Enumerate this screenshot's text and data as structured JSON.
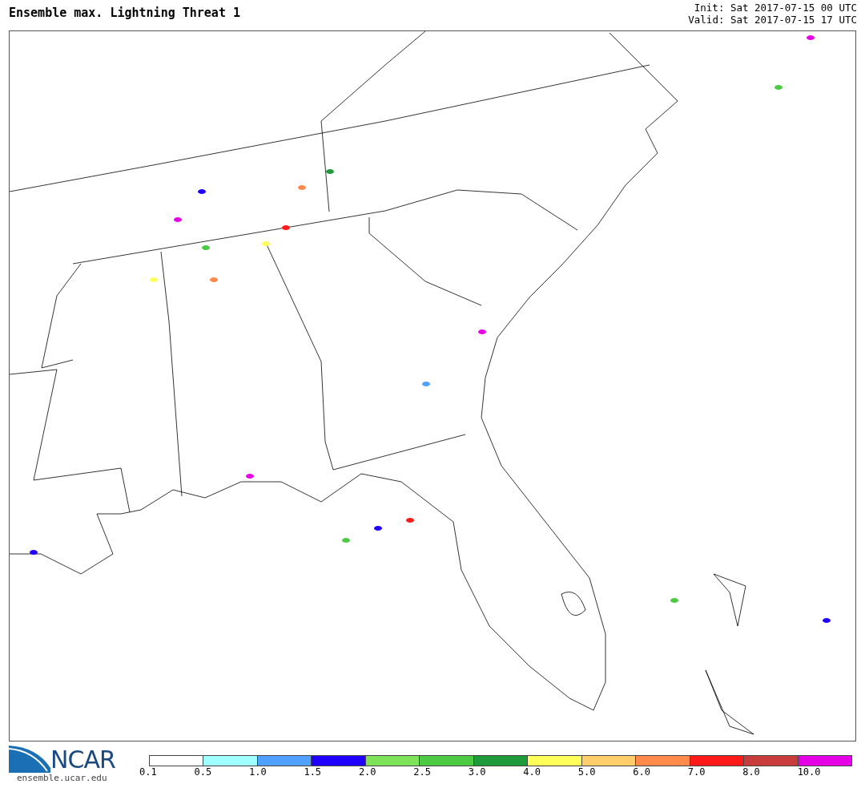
{
  "title": "Ensemble max. Lightning Threat 1",
  "init": "Init: Sat 2017-07-15 00 UTC",
  "valid": "Valid: Sat 2017-07-15 17 UTC",
  "logo": {
    "text": "NCAR",
    "url": "ensemble.ucar.edu"
  },
  "colorbar": {
    "bins": [
      {
        "color": "#ffffff",
        "label": "0.1"
      },
      {
        "color": "#a0ffff",
        "label": "0.5"
      },
      {
        "color": "#50a0ff",
        "label": "1.0"
      },
      {
        "color": "#1f00ff",
        "label": "1.5"
      },
      {
        "color": "#7fe35a",
        "label": "2.0"
      },
      {
        "color": "#4dca43",
        "label": "2.5"
      },
      {
        "color": "#1e9a3a",
        "label": "3.0"
      },
      {
        "color": "#ffff5a",
        "label": "4.0"
      },
      {
        "color": "#ffcd6a",
        "label": "5.0"
      },
      {
        "color": "#ff8a4a",
        "label": "6.0"
      },
      {
        "color": "#ff1a1a",
        "label": "7.0"
      },
      {
        "color": "#c83c3c",
        "label": "8.0"
      },
      {
        "color": "#e600e6",
        "label": "10.0"
      }
    ]
  }
}
